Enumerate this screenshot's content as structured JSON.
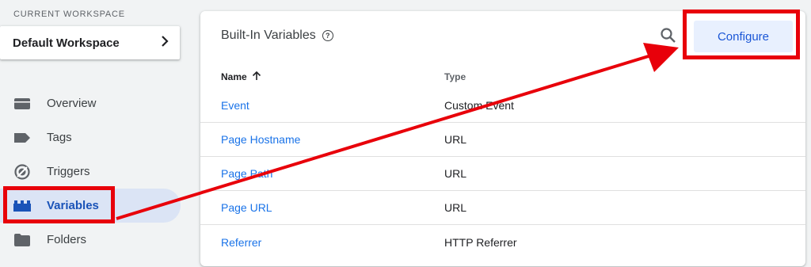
{
  "sidebar": {
    "workspace_heading": "CURRENT WORKSPACE",
    "workspace_name": "Default Workspace",
    "items": [
      {
        "label": "Overview",
        "icon": "overview-icon"
      },
      {
        "label": "Tags",
        "icon": "tag-icon"
      },
      {
        "label": "Triggers",
        "icon": "trigger-icon"
      },
      {
        "label": "Variables",
        "icon": "variables-icon",
        "active": true
      },
      {
        "label": "Folders",
        "icon": "folder-icon"
      }
    ]
  },
  "card": {
    "title": "Built-In Variables",
    "help_icon": "help-icon",
    "search_icon": "search-icon",
    "configure_label": "Configure",
    "columns": [
      "Name",
      "Type"
    ],
    "rows": [
      {
        "name": "Event",
        "type": "Custom Event"
      },
      {
        "name": "Page Hostname",
        "type": "URL"
      },
      {
        "name": "Page Path",
        "type": "URL"
      },
      {
        "name": "Page URL",
        "type": "URL"
      },
      {
        "name": "Referrer",
        "type": "HTTP Referrer"
      }
    ]
  },
  "colors": {
    "accent": "#1a73e8",
    "active_nav_bg": "#dbe4f5",
    "annotation_red": "#e8000a",
    "button_bg": "#e8f0fe"
  }
}
